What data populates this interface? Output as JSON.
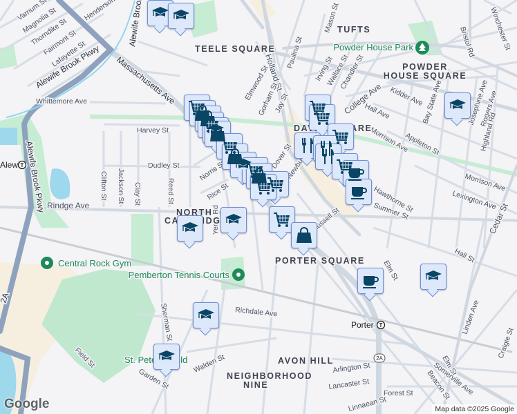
{
  "neighborhoods": [
    "TUFTS",
    "TEELE SQUARE",
    "POWDER",
    "HOUSE SQUARE",
    "DAVIS SQUARE",
    "NORTH",
    "CAMBRIDGE",
    "PORTER SQUARE",
    "AVON HILL",
    "NEIGHBORHOOD",
    "NINE"
  ],
  "pois": [
    "Powder House Park",
    "Central Rock Gym",
    "Pemberton Tennis Courts",
    "St. Peter's Field"
  ],
  "transit": [
    "Alewife",
    "Porter"
  ],
  "highways": [
    "Alewife Brook Pkwy",
    "Alewife Brook Pkwy",
    "Massachusetts Ave",
    "Alewife Brook Pkwy",
    "2A",
    "2A"
  ],
  "streets": [
    "Varnum St",
    "Magnolia St",
    "Thorndike St",
    "Fairmont St",
    "Lafayette St",
    "Henderson St",
    "Whittemore Ave",
    "Harvey St",
    "Dudley St",
    "Clifton St",
    "Jackson St",
    "Clay St",
    "Reed St",
    "Norris St",
    "Rice St",
    "Rindge Ave",
    "Yerxa Rd",
    "Richdale Ave",
    "Sherman St",
    "Field St",
    "Garden St",
    "Walden St",
    "Holland St",
    "Paulina St",
    "Mason St",
    "Irving St",
    "Wallace St",
    "Chandler St",
    "Gorham St",
    "Jay St",
    "Elmwood St",
    "College Ave",
    "Kidder Ave",
    "Hall Ave",
    "Morrison Ave",
    "Appleton St",
    "Bay State Ave",
    "Josephine Ave",
    "Rogers Ave",
    "Highland Rd",
    "Bristol Rd",
    "Winchester St",
    "Morrison Ave",
    "Lexington Ave",
    "Hawthorne St",
    "Summer St",
    "Russell St",
    "Elm St",
    "Elm St",
    "Hall St",
    "Cedar St",
    "Linden Ave",
    "Craigie St",
    "Somerville Ave",
    "Beacon St",
    "Arlington St",
    "Lancaster St",
    "Forest St",
    "Dover St",
    "Linnaean St",
    "Newbury St"
  ],
  "markers": [
    "school",
    "school",
    "grocery",
    "shopping",
    "shopping",
    "grocery",
    "school",
    "grocery",
    "grocery",
    "grocery",
    "grocery",
    "restaurant",
    "restaurant",
    "restaurant",
    "grocery",
    "cafe",
    "cafe",
    "grocery",
    "shopping",
    "cafe",
    "school",
    "school",
    "school",
    "school",
    "school",
    "school",
    "grocery"
  ],
  "footer": {
    "logo": "Google",
    "attribution": "Map data ©2025 Google"
  }
}
